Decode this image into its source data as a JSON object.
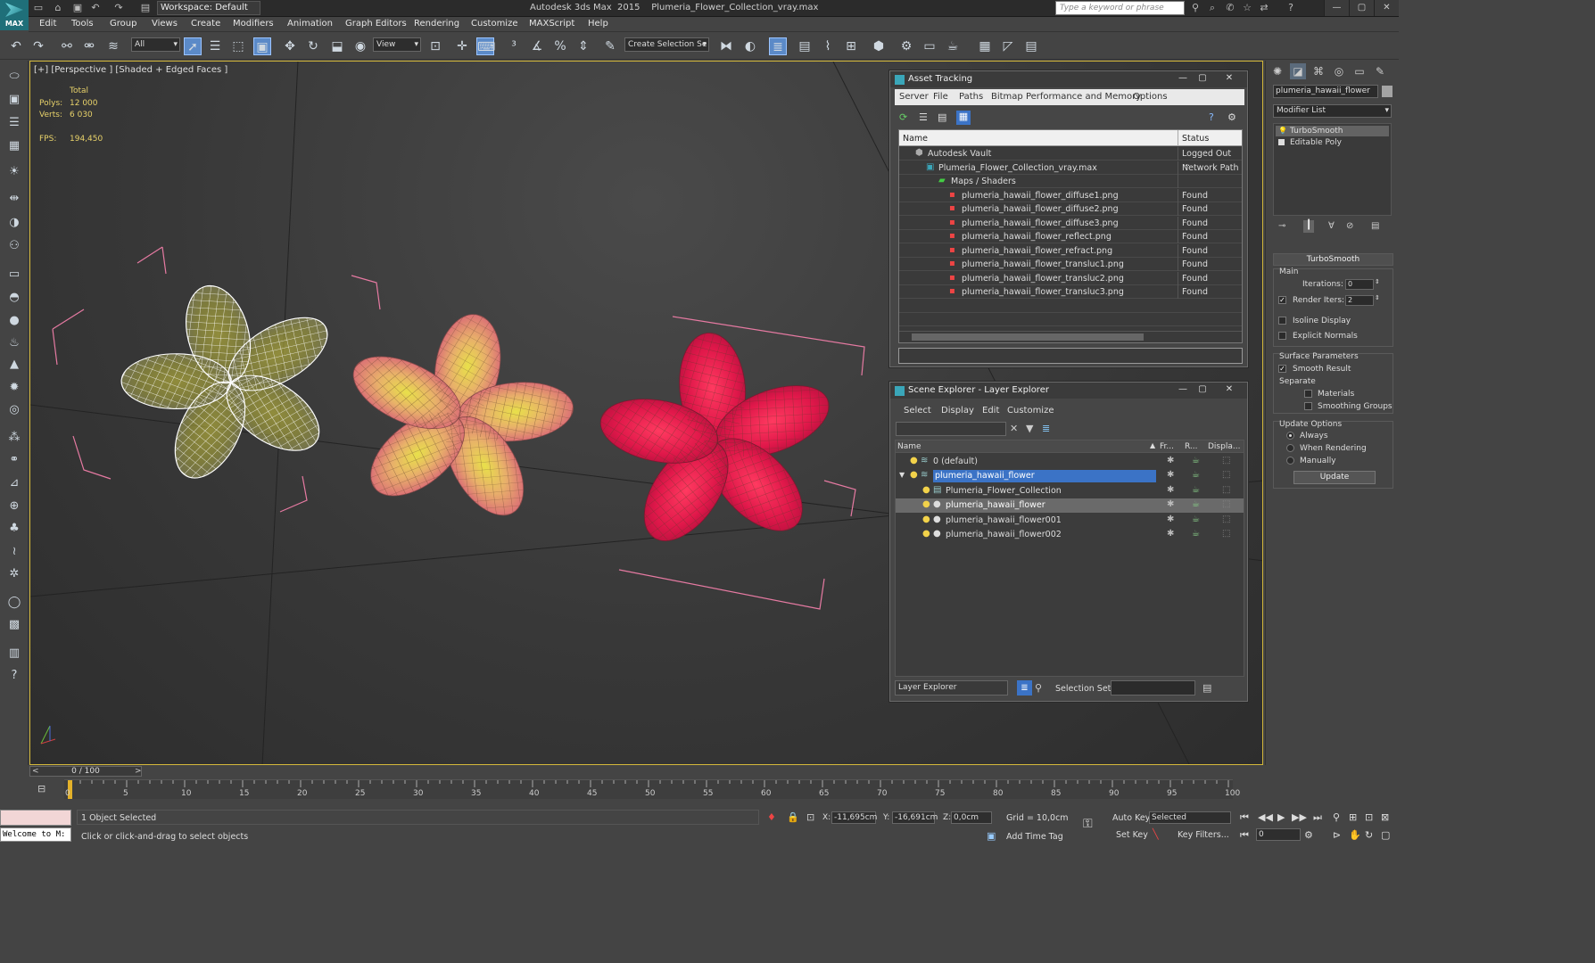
{
  "app": {
    "title": "Autodesk 3ds Max  2015    Plumeria_Flower_Collection_vray.max",
    "logo_label": "MAX",
    "workspace": "Workspace: Default",
    "search_placeholder": "Type a keyword or phrase"
  },
  "menu": [
    "Edit",
    "Tools",
    "Group",
    "Views",
    "Create",
    "Modifiers",
    "Animation",
    "Graph Editors",
    "Rendering",
    "Customize",
    "MAXScript",
    "Help"
  ],
  "toolbar": {
    "selection_filter": "All",
    "ref_coord": "View",
    "named_selection": "Create Selection Se"
  },
  "viewport": {
    "label": "[+] [Perspective ] [Shaded + Edged Faces ]",
    "stats_header": "Total",
    "polys_label": "Polys:",
    "polys_value": "12 000",
    "verts_label": "Verts:",
    "verts_value": "6 030",
    "fps_label": "FPS:",
    "fps_value": "194,450"
  },
  "asset_tracking": {
    "title": "Asset Tracking",
    "menu": [
      "Server",
      "File",
      "Paths",
      "Bitmap Performance and Memory",
      "Options"
    ],
    "col_name": "Name",
    "col_status": "Status",
    "rows": [
      {
        "name": "Autodesk Vault",
        "status": "Logged Out ..."
      },
      {
        "name": "Plumeria_Flower_Collection_vray.max",
        "status": "Network Path"
      },
      {
        "name": "Maps / Shaders",
        "status": ""
      },
      {
        "name": "plumeria_hawaii_flower_diffuse1.png",
        "status": "Found"
      },
      {
        "name": "plumeria_hawaii_flower_diffuse2.png",
        "status": "Found"
      },
      {
        "name": "plumeria_hawaii_flower_diffuse3.png",
        "status": "Found"
      },
      {
        "name": "plumeria_hawaii_flower_reflect.png",
        "status": "Found"
      },
      {
        "name": "plumeria_hawaii_flower_refract.png",
        "status": "Found"
      },
      {
        "name": "plumeria_hawaii_flower_transluc1.png",
        "status": "Found"
      },
      {
        "name": "plumeria_hawaii_flower_transluc2.png",
        "status": "Found"
      },
      {
        "name": "plumeria_hawaii_flower_transluc3.png",
        "status": "Found"
      }
    ]
  },
  "scene_explorer": {
    "title": "Scene Explorer - Layer Explorer",
    "menu": [
      "Select",
      "Display",
      "Edit",
      "Customize"
    ],
    "col_name": "Name",
    "col_freeze": "Fr...",
    "col_render": "R...",
    "col_display": "Displa...",
    "rows": [
      {
        "name": "0 (default)"
      },
      {
        "name": "plumeria_hawaii_flower"
      },
      {
        "name": "Plumeria_Flower_Collection"
      },
      {
        "name": "plumeria_hawaii_flower"
      },
      {
        "name": "plumeria_hawaii_flower001"
      },
      {
        "name": "plumeria_hawaii_flower002"
      }
    ],
    "footer_explorer": "Layer Explorer",
    "selection_set_label": "Selection Set:"
  },
  "command_panel": {
    "object_name": "plumeria_hawaii_flower",
    "modifier_list": "Modifier List",
    "stack": [
      "TurboSmooth",
      "Editable Poly"
    ],
    "rollout_title": "TurboSmooth",
    "main_label": "Main",
    "iterations_label": "Iterations:",
    "iterations_value": "0",
    "render_iters_label": "Render Iters:",
    "render_iters_value": "2",
    "isoline_label": "Isoline Display",
    "explicit_normals_label": "Explicit Normals",
    "surface_params_label": "Surface Parameters",
    "smooth_result_label": "Smooth Result",
    "separate_label": "Separate",
    "materials_label": "Materials",
    "smoothing_groups_label": "Smoothing Groups",
    "update_options_label": "Update Options",
    "always_label": "Always",
    "when_rendering_label": "When Rendering",
    "manually_label": "Manually",
    "update_button": "Update"
  },
  "timeline": {
    "frame_slider": "0 / 100",
    "ticks": [
      "0",
      "5",
      "10",
      "15",
      "20",
      "25",
      "30",
      "35",
      "40",
      "45",
      "50",
      "55",
      "60",
      "65",
      "70",
      "75",
      "80",
      "85",
      "90",
      "95",
      "100"
    ]
  },
  "status": {
    "selected": "1 Object Selected",
    "prompt": "Click or click-and-drag to select objects",
    "listener": "Welcome to M:",
    "x_label": "X:",
    "x_value": "-11,695cm",
    "y_label": "Y:",
    "y_value": "-16,691cm",
    "z_label": "Z:",
    "z_value": "0,0cm",
    "grid": "Grid = 10,0cm",
    "auto_key": "Auto Key",
    "set_key": "Set Key",
    "key_mode": "Selected",
    "key_filters": "Key Filters...",
    "add_time_tag": "Add Time Tag",
    "frame_value": "0"
  }
}
